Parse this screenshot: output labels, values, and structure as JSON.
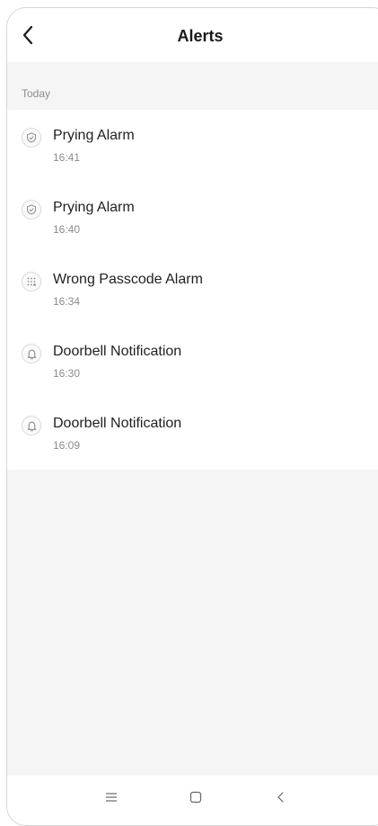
{
  "header": {
    "title": "Alerts",
    "back_icon": "chevron-left-icon"
  },
  "section": {
    "label": "Today"
  },
  "alerts": [
    {
      "title": "Prying Alarm",
      "time": "16:41",
      "icon": "shield-check-icon"
    },
    {
      "title": "Prying Alarm",
      "time": "16:40",
      "icon": "shield-check-icon"
    },
    {
      "title": "Wrong Passcode Alarm",
      "time": "16:34",
      "icon": "keypad-icon"
    },
    {
      "title": "Doorbell Notification",
      "time": "16:30",
      "icon": "bell-icon"
    },
    {
      "title": "Doorbell Notification",
      "time": "16:09",
      "icon": "bell-icon"
    }
  ],
  "navbar": {
    "menu_icon": "menu-icon",
    "home_icon": "home-square-icon",
    "back_icon": "back-chevron-icon"
  },
  "colors": {
    "background": "#f5f5f5",
    "card": "#ffffff",
    "text_primary": "#1f1f1f",
    "text_secondary": "#8c8c8c"
  }
}
